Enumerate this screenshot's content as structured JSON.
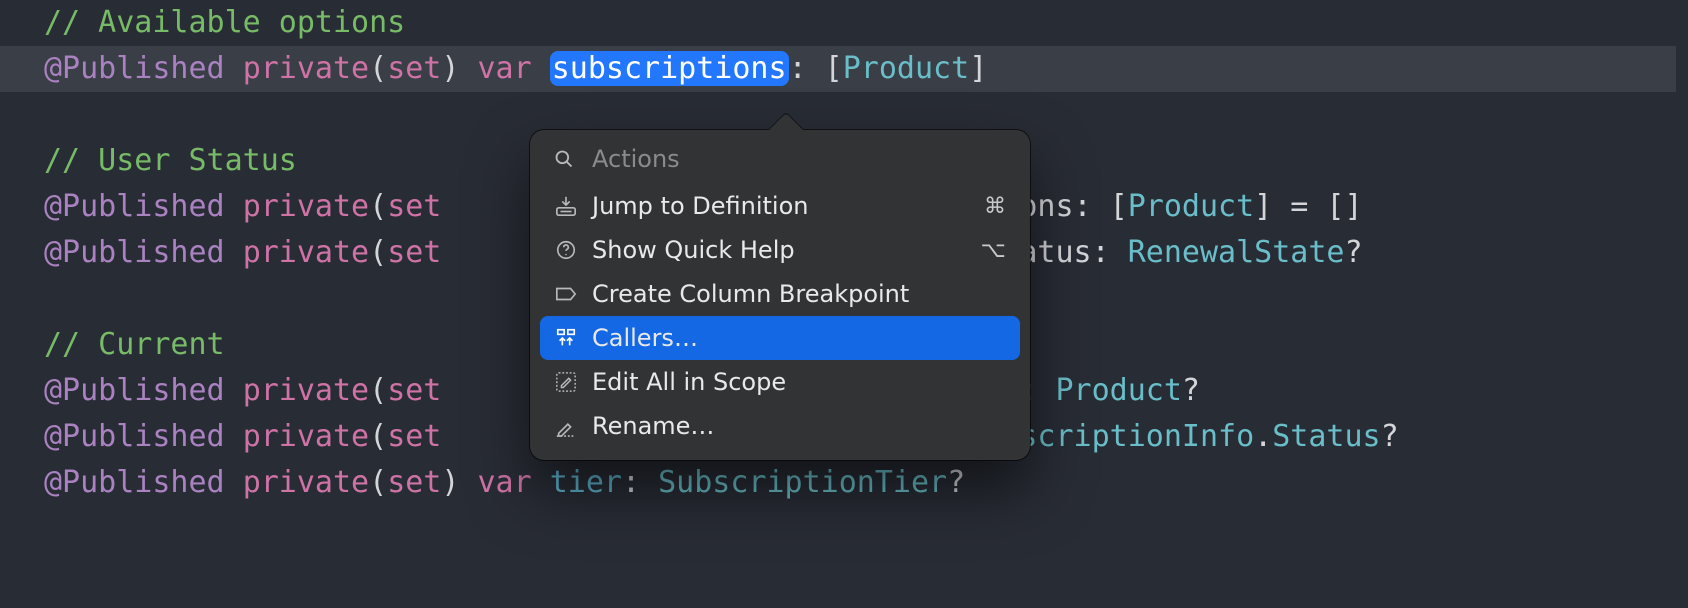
{
  "code": {
    "comment1": "// Available options",
    "comment2": "// User Status",
    "comment3": "// Current",
    "at_published": "@Published",
    "private": "private",
    "set": "set",
    "var": "var",
    "subscriptions": "subscriptions",
    "product": "Product",
    "tions_label": "tions",
    "status_label": "Status",
    "renewal_state": "RenewalState",
    "on_label": "on",
    "ubscription_info": "ubscriptionInfo",
    "dot_status": "Status",
    "tier": "tier",
    "subscription_tier": "SubscriptionTier",
    "empty_arr": " = []"
  },
  "popover": {
    "placeholder": "Actions",
    "value": "",
    "items": [
      {
        "label": "Jump to Definition",
        "shortcut": "⌘"
      },
      {
        "label": "Show Quick Help",
        "shortcut": "⌥"
      },
      {
        "label": "Create Column Breakpoint",
        "shortcut": ""
      },
      {
        "label": "Callers…",
        "shortcut": ""
      },
      {
        "label": "Edit All in Scope",
        "shortcut": ""
      },
      {
        "label": "Rename…",
        "shortcut": ""
      }
    ],
    "selected_index": 3
  }
}
